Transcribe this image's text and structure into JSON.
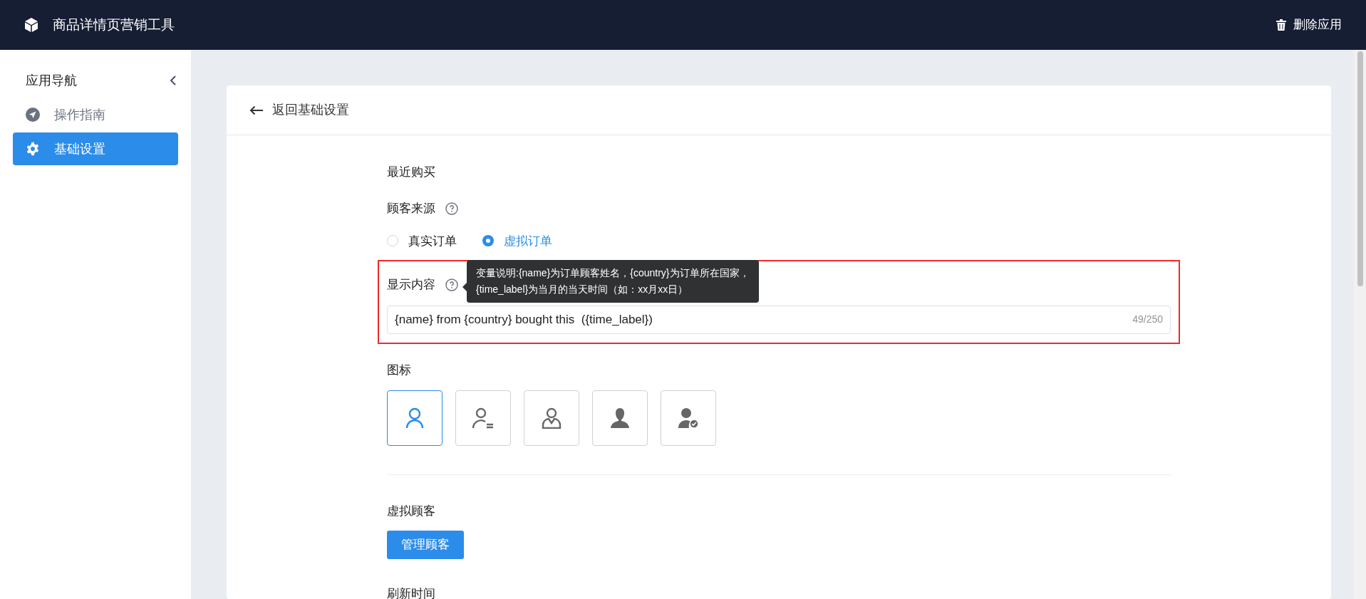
{
  "header": {
    "title": "商品详情页营销工具",
    "action": "删除应用"
  },
  "sidebar": {
    "title": "应用导航",
    "items": [
      {
        "label": "操作指南",
        "kind": "guide",
        "selected": false
      },
      {
        "label": "基础设置",
        "kind": "settings",
        "selected": true
      }
    ]
  },
  "card": {
    "back": "返回基础设置",
    "section_title": "最近购买",
    "source": {
      "label": "顾客来源",
      "options": [
        {
          "label": "真实订单",
          "selected": false
        },
        {
          "label": "虚拟订单",
          "selected": true
        }
      ]
    },
    "content": {
      "label": "显示内容",
      "value": "{name} from {country} bought this  ({time_label})",
      "counter": "49/250",
      "tooltip": [
        "变量说明:{name}为订单顾客姓名，{country}为订单所在国家，",
        "{time_label}为当月的当天时间（如：xx月xx日）"
      ]
    },
    "icon_label": "图标",
    "icons": [
      {
        "kind": "outline",
        "selected": true
      },
      {
        "kind": "outline-lines",
        "selected": false
      },
      {
        "kind": "outline-tie",
        "selected": false
      },
      {
        "kind": "solid",
        "selected": false
      },
      {
        "kind": "solid-check",
        "selected": false
      }
    ],
    "virtual_label": "虚拟顾客",
    "manage_button": "管理顾客",
    "refresh_label": "刷新时间"
  }
}
